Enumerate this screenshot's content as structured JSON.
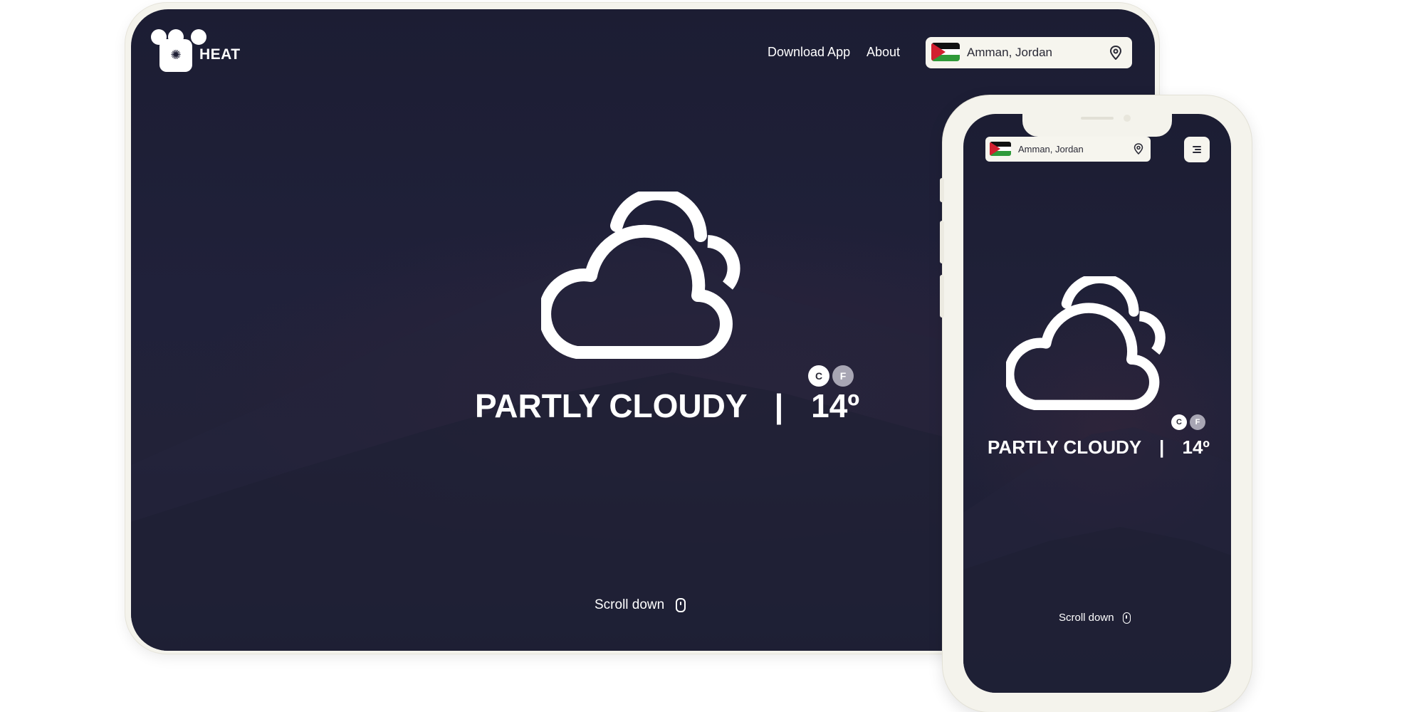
{
  "brand": {
    "name": "HEAT",
    "logo_icon": "sun-icon"
  },
  "nav": {
    "links": [
      "Download App",
      "About"
    ]
  },
  "location": {
    "text": "Amman, Jordan",
    "flag": "jordan-flag-icon",
    "pin_icon": "location-pin-icon"
  },
  "weather": {
    "condition": "PARTLY CLOUDY",
    "separator": "|",
    "temperature": "14º",
    "units": [
      "C",
      "F"
    ],
    "selected_unit": "C",
    "icon": "partly-cloudy-icon"
  },
  "scroll": {
    "label": "Scroll down",
    "icon": "mouse-icon"
  },
  "mobile": {
    "menu_icon": "hamburger-menu-icon"
  },
  "colors": {
    "background": "#1f2037",
    "device_frame": "#f4f3ec",
    "text": "#ffffff",
    "unit_inactive": "#a8a6b4"
  }
}
